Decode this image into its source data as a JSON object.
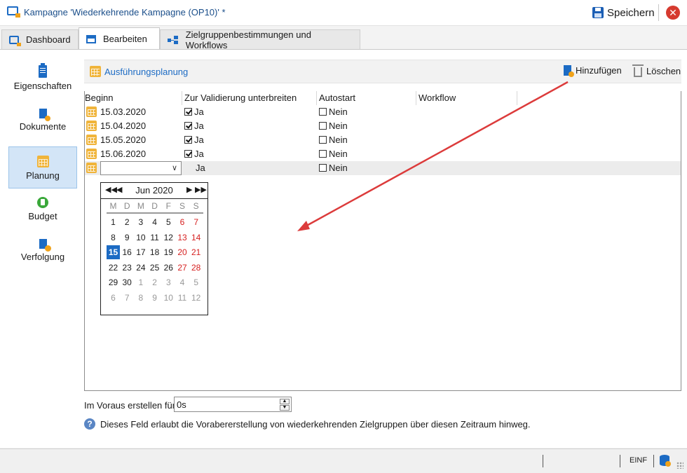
{
  "window": {
    "title": "Kampagne 'Wiederkehrende Kampagne (OP10)' *",
    "save_label": "Speichern",
    "close_symbol": "✕"
  },
  "tabs": [
    {
      "label": "Dashboard",
      "icon": "dashboard-icon"
    },
    {
      "label": "Bearbeiten",
      "icon": "edit-icon",
      "active": true
    },
    {
      "label": "Zielgruppenbestimmungen und Workflows",
      "icon": "workflow-icon"
    }
  ],
  "sidebar": {
    "items": [
      {
        "label": "Eigenschaften",
        "icon": "clipboard-icon"
      },
      {
        "label": "Dokumente",
        "icon": "document-icon"
      },
      {
        "label": "Planung",
        "icon": "calendar-icon",
        "active": true
      },
      {
        "label": "Budget",
        "icon": "budget-icon"
      },
      {
        "label": "Verfolgung",
        "icon": "tracking-icon"
      }
    ]
  },
  "panel": {
    "title": "Ausführungsplanung",
    "add_label": "Hinzufügen",
    "delete_label": "Löschen"
  },
  "table": {
    "columns": [
      "Beginn",
      "Zur Validierung unterbreiten",
      "Autostart",
      "Workflow"
    ],
    "rows": [
      {
        "date": "15.03.2020",
        "validate": "Ja",
        "validate_checked": true,
        "autostart": "Nein",
        "autostart_checked": false,
        "workflow": ""
      },
      {
        "date": "15.04.2020",
        "validate": "Ja",
        "validate_checked": true,
        "autostart": "Nein",
        "autostart_checked": false,
        "workflow": ""
      },
      {
        "date": "15.05.2020",
        "validate": "Ja",
        "validate_checked": true,
        "autostart": "Nein",
        "autostart_checked": false,
        "workflow": ""
      },
      {
        "date": "15.06.2020",
        "validate": "Ja",
        "validate_checked": true,
        "autostart": "Nein",
        "autostart_checked": false,
        "workflow": ""
      },
      {
        "date": "",
        "validate": "Ja",
        "validate_checked": false,
        "autostart": "Nein",
        "autostart_checked": false,
        "workflow": ""
      }
    ]
  },
  "calendar": {
    "month_label": "Jun 2020",
    "nav": {
      "prev_year": "◀◀",
      "prev_month": "◀",
      "next_month": "▶",
      "next_year": "▶▶"
    },
    "weekdays": [
      "M",
      "D",
      "M",
      "D",
      "F",
      "S",
      "S"
    ],
    "weeks": [
      [
        "1",
        "2",
        "3",
        "4",
        "5",
        "6",
        "7"
      ],
      [
        "8",
        "9",
        "10",
        "11",
        "12",
        "13",
        "14"
      ],
      [
        "15",
        "16",
        "17",
        "18",
        "19",
        "20",
        "21"
      ],
      [
        "22",
        "23",
        "24",
        "25",
        "26",
        "27",
        "28"
      ],
      [
        "29",
        "30",
        "1",
        "2",
        "3",
        "4",
        "5"
      ],
      [
        "6",
        "7",
        "8",
        "9",
        "10",
        "11",
        "12"
      ]
    ],
    "selected_day": "15",
    "accent_color": "#1c6bc4",
    "weekend_color": "#d62020"
  },
  "footer": {
    "advance_label": "Im Voraus erstellen für:",
    "advance_value": "0s",
    "info_text": "Dieses Feld erlaubt die Vorabererstellung von wiederkehrenden Zielgruppen über diesen Zeitraum hinweg.",
    "info_icon": "info-icon"
  },
  "statusbar": {
    "mode": "EINF"
  }
}
